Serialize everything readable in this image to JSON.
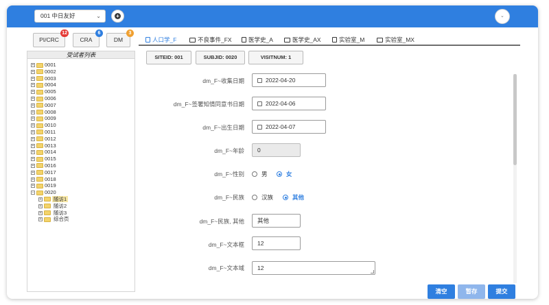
{
  "header": {
    "project_select_value": "001 中日友好",
    "add_label": "+",
    "user_menu_chevron": "⌄"
  },
  "roles": [
    {
      "label": "PI/CRC",
      "badge": "12",
      "badge_color": "#e53935"
    },
    {
      "label": "CRA",
      "badge": "6",
      "badge_color": "#2f7fe0"
    },
    {
      "label": "DM",
      "badge": "3",
      "badge_color": "#f0a030"
    }
  ],
  "tree": {
    "title": "受试者列表",
    "subjects": [
      "0001",
      "0002",
      "0003",
      "0004",
      "0005",
      "0006",
      "0007",
      "0008",
      "0009",
      "0010",
      "0011",
      "0012",
      "0013",
      "0014",
      "0015",
      "0016",
      "0017",
      "0018",
      "0019",
      "0020"
    ],
    "expanded_subject": "0020",
    "visits": [
      "随访1",
      "随访2",
      "随访3",
      "综合页"
    ],
    "selected_visit": "随访1"
  },
  "tabs": [
    {
      "label": "人口学_F",
      "active": true,
      "icon": "document-icon"
    },
    {
      "label": "不良事件_FX",
      "active": false,
      "icon": "folder-icon"
    },
    {
      "label": "医学史_A",
      "active": false,
      "icon": "document-icon"
    },
    {
      "label": "医学史_AX",
      "active": false,
      "icon": "folder-icon"
    },
    {
      "label": "实验室_M",
      "active": false,
      "icon": "document-icon"
    },
    {
      "label": "实验室_MX",
      "active": false,
      "icon": "folder-icon"
    }
  ],
  "info_buttons": {
    "siteid": "SITEID: 001",
    "subjid": "SUBJID: 0020",
    "visitnum": "VISITNUM: 1"
  },
  "form": {
    "collect_date_label": "dm_F~收集日期",
    "collect_date_value": "2022-04-20",
    "consent_date_label": "dm_F~签署知情同意书日期",
    "consent_date_value": "2022-04-06",
    "birth_date_label": "dm_F~出生日期",
    "birth_date_value": "2022-04-07",
    "age_label": "dm_F~年龄",
    "age_value": "0",
    "gender_label": "dm_F~性别",
    "gender_options": [
      "男",
      "女"
    ],
    "gender_selected": "女",
    "ethnicity_label": "dm_F~民族",
    "ethnicity_options": [
      "汉族",
      "其他"
    ],
    "ethnicity_selected": "其他",
    "ethnicity_other_label": "dm_F~民族, 其他",
    "ethnicity_other_value": "其他",
    "textbox_label": "dm_F~文本框",
    "textbox_value": "12",
    "textarea_label": "dm_F~文本域",
    "textarea_value": "12"
  },
  "actions": {
    "clear": "清空",
    "save_draft": "暂存",
    "submit": "提交"
  },
  "colors": {
    "primary": "#2f7fe0",
    "disabled": "#8fb6ec",
    "tree_selected": "#f7e7a6"
  }
}
